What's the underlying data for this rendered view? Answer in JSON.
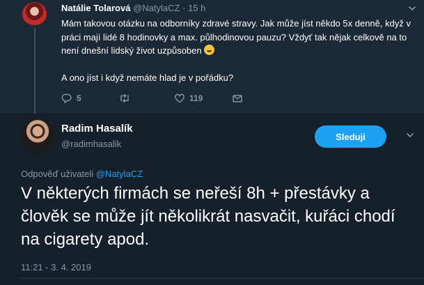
{
  "parent_tweet": {
    "author_name": "Natálie Tolarová",
    "author_handle": "@NatylaCZ",
    "separator": "·",
    "time": "15 h",
    "text_line1": "Mám takovou otázku na odborníky zdravé stravy. Jak může jíst někdo 5x denně, když v práci mají lidé 8 hodinovky a max. půlhodinovou pauzu? Vždyť tak nějak celkově na to není dnešní lidský život uzpůsoben",
    "text_line2": "A ono jíst i když nemáte hlad je v pořádku?",
    "reply_count": "5",
    "retweet_count": "",
    "like_count": "119",
    "icons": [
      "reply-icon",
      "retweet-icon",
      "like-icon",
      "dm-icon",
      "chevron-down-icon"
    ]
  },
  "main_tweet": {
    "author_name": "Radim Hasalík",
    "author_handle": "@radimhasalik",
    "follow_label": "Sleduji",
    "reply_prefix": "Odpověď uživateli",
    "reply_mention": "@NatylaCZ",
    "text": "V některých firmách se neřeší 8h + přestávky a člověk se může jít několikrát nasvačit, kuřáci chodí na cigarety apod.",
    "timestamp": "11:21 - 3. 4. 2019"
  },
  "colors": {
    "accent": "#1da1f2",
    "background": "#15202b",
    "parent_background": "#1b2836",
    "muted_text": "#8899a6"
  }
}
